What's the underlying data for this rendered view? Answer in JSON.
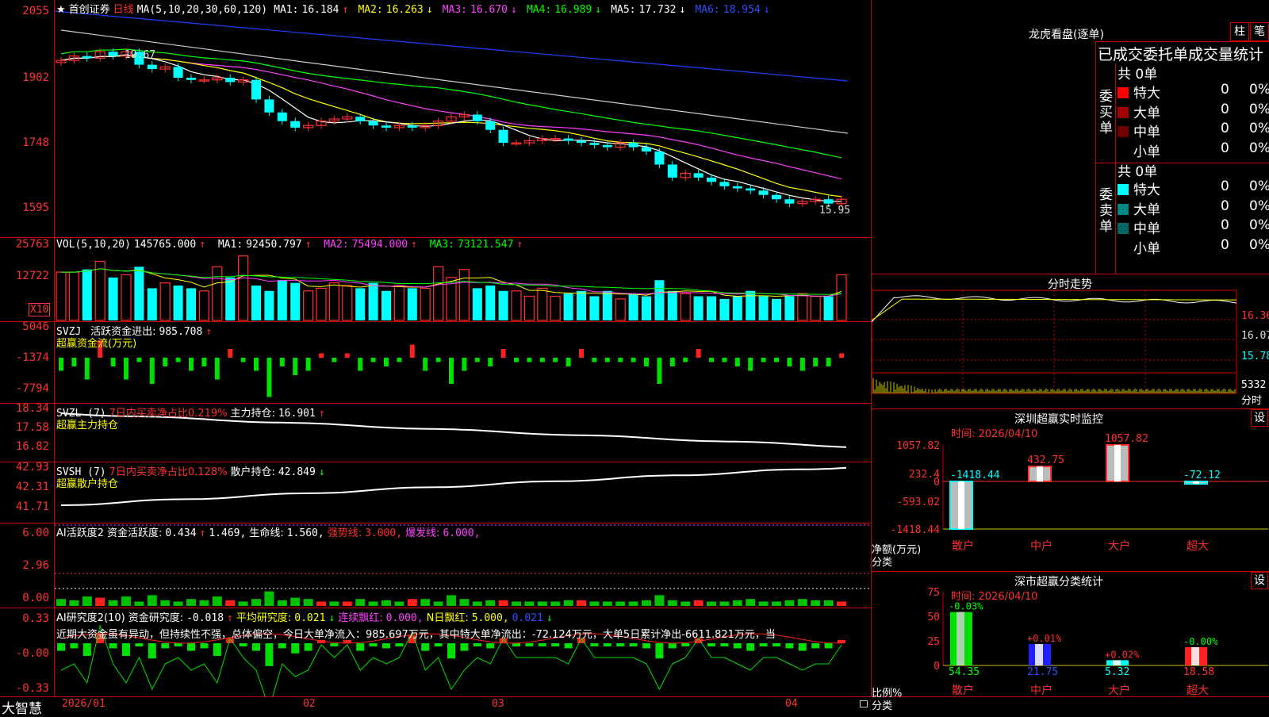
{
  "title_star": "★",
  "stock_name": "首创证券",
  "period": "日线",
  "main_pane": {
    "ma_label": "MA(5,10,20,30,60,120)",
    "ma": [
      {
        "name": "MA1:",
        "value": "16.184",
        "arrow": "↑",
        "color": "#ffffff"
      },
      {
        "name": "MA2:",
        "value": "16.263",
        "arrow": "↓",
        "color": "#ffff00"
      },
      {
        "name": "MA3:",
        "value": "16.670",
        "arrow": "↓",
        "color": "#ff40ff"
      },
      {
        "name": "MA4:",
        "value": "16.989",
        "arrow": "↓",
        "color": "#00ff00"
      },
      {
        "name": "MA5:",
        "value": "17.732",
        "arrow": "↓",
        "color": "#ffffff"
      },
      {
        "name": "MA6:",
        "value": "18.954",
        "arrow": "↓",
        "color": "#3050ff"
      }
    ],
    "y_labels": [
      "2055",
      "1902",
      "1748",
      "1595"
    ],
    "high_mark": "19.67",
    "low_mark": "15.95",
    "closes": [
      19.4,
      19.5,
      19.45,
      19.6,
      19.5,
      19.6,
      19.3,
      19.2,
      19.25,
      19.0,
      18.95,
      18.95,
      19.0,
      18.9,
      18.95,
      18.5,
      18.2,
      18.0,
      17.85,
      17.9,
      18.0,
      18.05,
      18.1,
      18.0,
      17.9,
      17.85,
      17.9,
      17.85,
      17.9,
      18.0,
      18.1,
      18.15,
      18.0,
      17.8,
      17.5,
      17.5,
      17.55,
      17.6,
      17.6,
      17.55,
      17.5,
      17.45,
      17.4,
      17.5,
      17.4,
      17.3,
      17.0,
      16.7,
      16.8,
      16.7,
      16.6,
      16.5,
      16.45,
      16.4,
      16.3,
      16.2,
      16.1,
      16.15,
      16.2,
      16.1,
      16.2
    ]
  },
  "vol_pane": {
    "label": "VOL(5,10,20)",
    "value": "145765.000",
    "arrow": "↑",
    "ma": [
      {
        "name": "MA1:",
        "value": "92450.797",
        "arrow": "↑",
        "color": "#ffffff"
      },
      {
        "name": "MA2:",
        "value": "75494.000",
        "arrow": "↑",
        "color": "#ff40ff"
      },
      {
        "name": "MA3:",
        "value": "73121.547",
        "arrow": "↑",
        "color": "#00ff00"
      }
    ],
    "y_labels": [
      "25763",
      "12722"
    ],
    "unit": "X10",
    "values": [
      90,
      90,
      95,
      110,
      80,
      85,
      100,
      60,
      70,
      65,
      60,
      55,
      100,
      80,
      120,
      65,
      55,
      75,
      70,
      55,
      60,
      70,
      65,
      60,
      70,
      55,
      65,
      60,
      60,
      100,
      80,
      95,
      60,
      65,
      55,
      55,
      45,
      60,
      45,
      50,
      55,
      45,
      55,
      40,
      50,
      45,
      75,
      55,
      50,
      45,
      45,
      40,
      45,
      55,
      45,
      40,
      45,
      50,
      45,
      45,
      85
    ]
  },
  "svzj_pane": {
    "label": "SVZJ",
    "line1_name": "活跃资金进出:",
    "line1_value": "985.708",
    "line1_arrow": "↑",
    "line2": "超赢资金流(万元)",
    "y_labels": [
      "5046",
      "-1374",
      "-7794"
    ],
    "values": [
      -3,
      -2,
      -5,
      4,
      -2,
      -5,
      -1,
      -6,
      -2,
      -1,
      -3,
      -2,
      -5,
      2,
      -1,
      -3,
      -9,
      -2,
      -4,
      -3,
      1,
      -1,
      1,
      -3,
      -1,
      -2,
      -1,
      3,
      -3,
      -1,
      -6,
      -3,
      -1,
      -2,
      2,
      -1,
      -1,
      -1,
      -1,
      -2,
      2,
      -1,
      -1,
      -1,
      -1,
      -2,
      -6,
      -2,
      -1,
      2,
      -1,
      -1,
      -2,
      -3,
      -1,
      -1,
      -2,
      -3,
      -2,
      -2,
      1
    ]
  },
  "svzl_pane": {
    "label": "SVZL (7)",
    "desc": "7日内买卖净占比0.219%",
    "main_name": "主力持仓:",
    "main_value": "16.901",
    "main_arrow": "↑",
    "line2": "超赢主力持仓",
    "y_labels": [
      "18.34",
      "17.58",
      "16.82"
    ]
  },
  "svsh_pane": {
    "label": "SVSH (7)",
    "desc": "7日内买卖净占比0.128%",
    "main_name": "散户持仓:",
    "main_value": "42.849",
    "main_arrow": "↓",
    "line2": "超赢散户持仓",
    "y_labels": [
      "42.93",
      "42.31",
      "41.71"
    ]
  },
  "ai_active_pane": {
    "label": "AI活跃度2",
    "name1": "资金活跃度:",
    "v1": "0.434",
    "a1": "↑",
    "v2": "1.469,",
    "name3": "生命线:",
    "v3": "1.560,",
    "name4": "强势线:",
    "v4": "3.000,",
    "name5": "爆发线:",
    "v5": "6.000,",
    "y_labels": [
      "6.00",
      "2.96",
      "0.00"
    ]
  },
  "ai_research_pane": {
    "label": "AI研究度2(10)",
    "name1": "资金研究度:",
    "v1": "-0.018",
    "a1": "↑",
    "name2": "平均研究度:",
    "v2": "0.021",
    "a2": "↓",
    "name3": "连续飘红:",
    "v3": "0.000,",
    "name4": "N日飘红:",
    "v4": "5.000,",
    "v5": "0.021",
    "a5": "↓",
    "comment": "近期大资金虽有异动，但持续性不强，总体偏空，今日大单净流入：985.697万元，其中特大单净流出：-72.124万元，大单5日累计净出-6611.821万元，当",
    "y_labels": [
      "0.33",
      "-0.00",
      "-0.33"
    ]
  },
  "bottom_bar": {
    "brand": "大智慧",
    "dates": [
      "2026/01",
      "02",
      "03",
      "04"
    ]
  },
  "dragon_panel": {
    "title": "龙虎看盘(逐单)",
    "btn1": "柱",
    "btn2": "笔",
    "subtitle": "已成交委托单成交量统计",
    "buy_label": "委买单",
    "sell_label": "委卖单",
    "buy_total": "共 0单",
    "sell_total": "共 0单",
    "buy_rows": [
      {
        "name": "特大",
        "count": "0",
        "pct": "0%",
        "color": "#ff0000"
      },
      {
        "name": "大单",
        "count": "0",
        "pct": "0%",
        "color": "#a00000"
      },
      {
        "name": "中单",
        "count": "0",
        "pct": "0%",
        "color": "#700000"
      },
      {
        "name": "小单",
        "count": "0",
        "pct": "0%",
        "color": ""
      }
    ],
    "sell_rows": [
      {
        "name": "特大",
        "count": "0",
        "pct": "0%",
        "color": "#00ffff"
      },
      {
        "name": "大单",
        "count": "0",
        "pct": "0%",
        "color": "#008888"
      },
      {
        "name": "中单",
        "count": "0",
        "pct": "0%",
        "color": "#006666"
      },
      {
        "name": "小单",
        "count": "0",
        "pct": "0%",
        "color": ""
      }
    ]
  },
  "minute_panel": {
    "title": "分时走势",
    "y_labels": [
      "16.36",
      "16.07",
      "15.78"
    ],
    "vol_label": "5332",
    "foot_label": "分时"
  },
  "monitor_panel": {
    "title": "深圳超赢实时监控",
    "btn": "设",
    "time": "时间: 2026/04/10",
    "y_labels": [
      "1057.82",
      "232.4",
      "0",
      "-593.02",
      "-1418.44"
    ],
    "axis_name": "净额(万元)",
    "axis_name2": "分类",
    "categories": [
      "散户",
      "中户",
      "大户",
      "超大"
    ],
    "values": [
      -1418.44,
      432.75,
      1057.82,
      -72.12
    ],
    "value_labels": [
      "-1418.44",
      "432.75",
      "1057.82",
      "-72.12"
    ]
  },
  "classify_panel": {
    "title": "深市超赢分类统计",
    "btn": "设",
    "time": "时间: 2026/04/10",
    "y_labels": [
      "75",
      "50",
      "25",
      "0"
    ],
    "axis_name": "比例%",
    "axis_name2": "分类",
    "categories": [
      "散户",
      "中户",
      "大户",
      "超大"
    ],
    "values": [
      54.35,
      21.75,
      5.32,
      18.58
    ],
    "value_labels": [
      "54.35",
      "21.75",
      "5.32",
      "18.58"
    ],
    "change_labels": [
      "-0.03%",
      "+0.01%",
      "+0.02%",
      "-0.00%"
    ]
  }
}
